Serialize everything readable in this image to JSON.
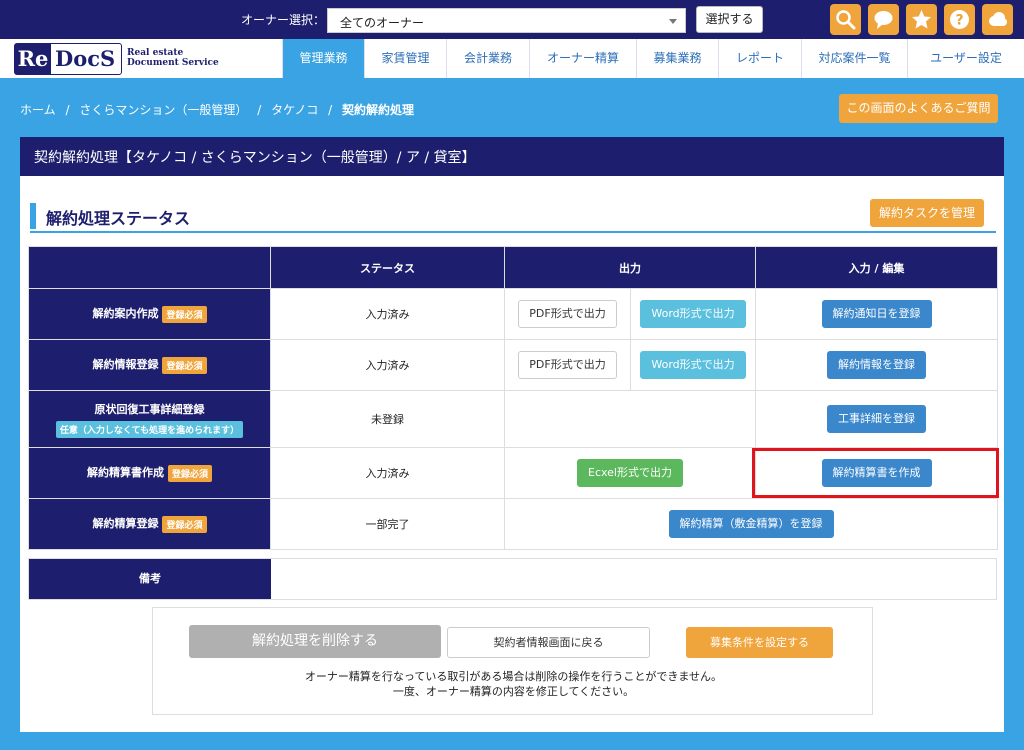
{
  "topbar": {
    "owner_label": "オーナー選択：",
    "owner_value": "全てのオーナー",
    "select_button": "選択する",
    "icons": [
      "search-icon",
      "chat-icon",
      "star-icon",
      "help-icon",
      "cloud-icon"
    ]
  },
  "logo": {
    "re": "Re",
    "docs": "DocS",
    "tagline1": "Real estate",
    "tagline2": "Document Service"
  },
  "nav": {
    "items": [
      "管理業務",
      "家賃管理",
      "会計業務",
      "オーナー精算",
      "募集業務",
      "レポート",
      "対応案件一覧",
      "ユーザー設定"
    ],
    "active": "管理業務"
  },
  "breadcrumb": {
    "items": [
      "ホーム",
      "さくらマンション（一般管理）",
      "タケノコ",
      "契約解約処理"
    ],
    "sep": "/"
  },
  "faq_button": "この画面のよくあるご質問",
  "panel": {
    "header": "契約解約処理【タケノコ / さくらマンション（一般管理）/ ア / 貸室】",
    "section_title": "解約処理ステータス",
    "manage_button": "解約タスクを管理"
  },
  "table": {
    "headers": [
      "",
      "ステータス",
      "出力",
      "入力 / 編集"
    ],
    "rows": [
      {
        "label": "解約案内作成",
        "badge": "登録必須",
        "status": "入力済み",
        "pdf": "PDF形式で出力",
        "word": "Word形式で出力",
        "edit": "解約通知日を登録"
      },
      {
        "label": "解約情報登録",
        "badge": "登録必須",
        "status": "入力済み",
        "pdf": "PDF形式で出力",
        "word": "Word形式で出力",
        "edit": "解約情報を登録"
      },
      {
        "label": "原状回復工事詳細登録",
        "badge": "任意（入力しなくても処理を進められます）",
        "status": "未登録",
        "edit": "工事詳細を登録"
      },
      {
        "label": "解約精算書作成",
        "badge": "登録必須",
        "status": "入力済み",
        "excel": "Ecxel形式で出力",
        "edit": "解約精算書を作成"
      },
      {
        "label": "解約精算登録",
        "badge": "登録必須",
        "status": "一部完了",
        "edit": "解約精算（敷金精算）を登録"
      }
    ]
  },
  "remarks": {
    "label": "備考",
    "value": ""
  },
  "bottom": {
    "delete_button": "解約処理を削除する",
    "back_button": "契約者情報画面に戻る",
    "recruit_button": "募集条件を設定する",
    "notice_line1": "オーナー精算を行なっている取引がある場合は削除の操作を行うことができません。",
    "notice_line2": "一度、オーナー精算の内容を修正してください。"
  }
}
